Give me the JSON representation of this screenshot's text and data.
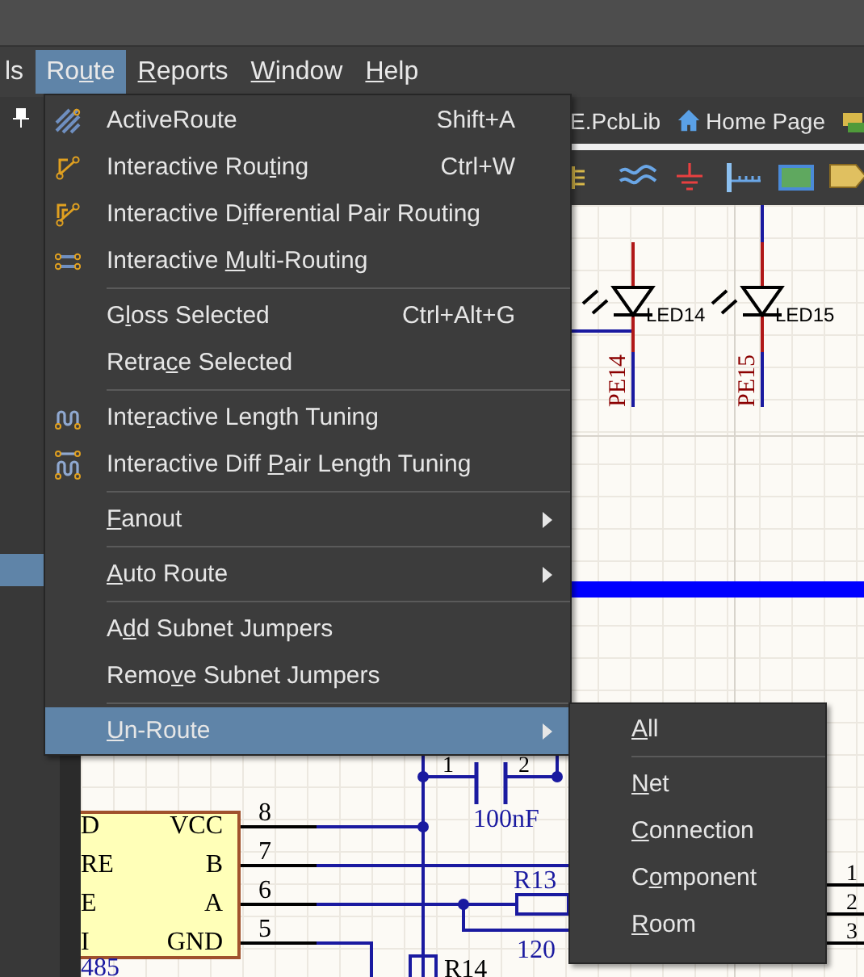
{
  "menu_bar": {
    "items": [
      {
        "label": {
          "pre": "ls"
        },
        "selected": false
      },
      {
        "label": {
          "pre": "Ro",
          "key": "u",
          "post": "te"
        },
        "selected": true
      },
      {
        "label": {
          "key": "R",
          "post": "eports"
        },
        "selected": false
      },
      {
        "label": {
          "key": "W",
          "post": "indow"
        },
        "selected": false
      },
      {
        "label": {
          "key": "H",
          "post": "elp"
        },
        "selected": false
      }
    ]
  },
  "document_tabs": [
    {
      "label": "E.PcbLib"
    },
    {
      "label": "Home Page"
    }
  ],
  "route_menu": {
    "items": [
      {
        "kind": "item",
        "label": {
          "pre": "ActiveRoute"
        },
        "shortcut": "Shift+A",
        "selected": false
      },
      {
        "kind": "item",
        "label": {
          "pre": "Interactive Rou",
          "key": "t",
          "post": "ing"
        },
        "shortcut": "Ctrl+W",
        "selected": false
      },
      {
        "kind": "item",
        "label": {
          "pre": "Interactive D",
          "key": "i",
          "post": "fferential Pair Routing"
        },
        "selected": false
      },
      {
        "kind": "item",
        "label": {
          "pre": "Interactive ",
          "key": "M",
          "post": "ulti-Routing"
        },
        "selected": false
      },
      {
        "kind": "separator"
      },
      {
        "kind": "item",
        "label": {
          "pre": "G",
          "key": "l",
          "post": "oss Selected"
        },
        "shortcut": "Ctrl+Alt+G",
        "selected": false
      },
      {
        "kind": "item",
        "label": {
          "pre": "Retra",
          "key": "c",
          "post": "e Selected"
        },
        "selected": false
      },
      {
        "kind": "separator"
      },
      {
        "kind": "item",
        "label": {
          "pre": "Inte",
          "key": "r",
          "post": "active Length Tuning"
        },
        "selected": false
      },
      {
        "kind": "item",
        "label": {
          "pre": "Interactive Diff ",
          "key": "P",
          "post": "air Length Tuning"
        },
        "selected": false
      },
      {
        "kind": "separator"
      },
      {
        "kind": "submenu",
        "label": {
          "key": "F",
          "post": "anout"
        },
        "selected": false
      },
      {
        "kind": "separator"
      },
      {
        "kind": "submenu",
        "label": {
          "key": "A",
          "post": "uto Route"
        },
        "selected": false
      },
      {
        "kind": "separator"
      },
      {
        "kind": "item",
        "label": {
          "pre": "A",
          "key": "d",
          "post": "d Subnet Jumpers"
        },
        "selected": false
      },
      {
        "kind": "item",
        "label": {
          "pre": "Remo",
          "key": "v",
          "post": "e Subnet Jumpers"
        },
        "selected": false
      },
      {
        "kind": "separator"
      },
      {
        "kind": "submenu",
        "label": {
          "key": "U",
          "post": "n-Route"
        },
        "selected": true
      }
    ]
  },
  "unroute_submenu": {
    "items": [
      {
        "kind": "item",
        "label": {
          "key": "A",
          "post": "ll"
        },
        "selected": false
      },
      {
        "kind": "separator"
      },
      {
        "kind": "item",
        "label": {
          "key": "N",
          "post": "et"
        },
        "selected": false
      },
      {
        "kind": "item",
        "label": {
          "key": "C",
          "post": "onnection"
        },
        "selected": false
      },
      {
        "kind": "item",
        "label": {
          "pre": "C",
          "key": "o",
          "post": "mponent"
        },
        "selected": false
      },
      {
        "kind": "item",
        "label": {
          "key": "R",
          "post": "oom"
        },
        "selected": false
      }
    ]
  },
  "schematic": {
    "labels": [
      "LED14",
      "LED15",
      "PE14",
      "PE15",
      "1",
      "2",
      "D",
      "VCC",
      "8",
      "100nF",
      "RE",
      "B",
      "7",
      "R13",
      "1",
      "E",
      "A",
      "6",
      "2",
      "I",
      "GND",
      "5",
      "120",
      "3",
      "485",
      "R14"
    ]
  }
}
